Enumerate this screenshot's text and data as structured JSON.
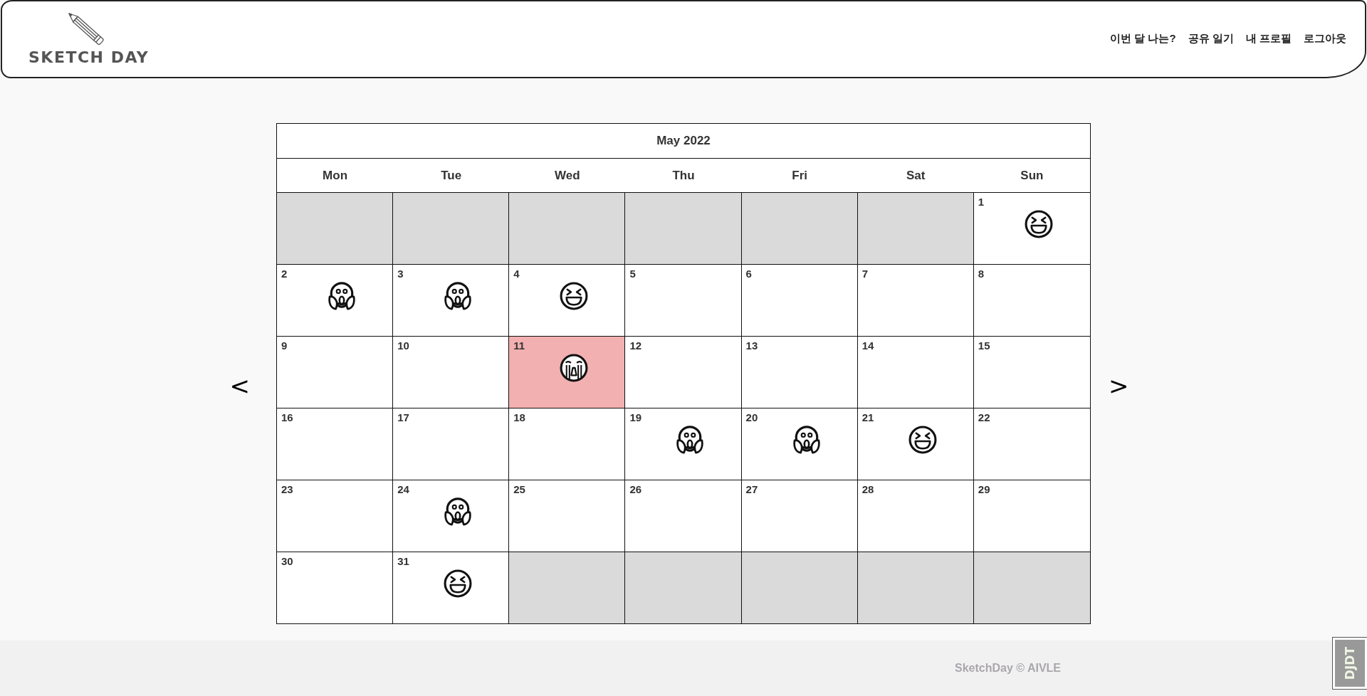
{
  "header": {
    "logo": "SKETCH DAY",
    "nav": [
      "이번 달 나는?",
      "공유 일기",
      "내 프로필",
      "로그아웃"
    ]
  },
  "calendar": {
    "prev": "<",
    "next": ">",
    "title": "May 2022",
    "weekdays": [
      "Mon",
      "Tue",
      "Wed",
      "Thu",
      "Fri",
      "Sat",
      "Sun"
    ],
    "weeks": [
      {
        "days": [
          {
            "kind": "blank"
          },
          {
            "kind": "blank"
          },
          {
            "kind": "blank"
          },
          {
            "kind": "blank"
          },
          {
            "kind": "blank"
          },
          {
            "kind": "blank"
          },
          {
            "kind": "day",
            "day": "1",
            "today": false,
            "mood": {
              "kind": "joy"
            }
          }
        ]
      },
      {
        "days": [
          {
            "kind": "day",
            "day": "2",
            "today": false,
            "mood": {
              "kind": "fear"
            }
          },
          {
            "kind": "day",
            "day": "3",
            "today": false,
            "mood": {
              "kind": "fear"
            }
          },
          {
            "kind": "day",
            "day": "4",
            "today": false,
            "mood": {
              "kind": "joy"
            }
          },
          {
            "kind": "day",
            "day": "5",
            "today": false
          },
          {
            "kind": "day",
            "day": "6",
            "today": false
          },
          {
            "kind": "day",
            "day": "7",
            "today": false
          },
          {
            "kind": "day",
            "day": "8",
            "today": false
          }
        ]
      },
      {
        "days": [
          {
            "kind": "day",
            "day": "9",
            "today": false
          },
          {
            "kind": "day",
            "day": "10",
            "today": false
          },
          {
            "kind": "day",
            "day": "11",
            "today": true,
            "mood": {
              "kind": "sadness"
            }
          },
          {
            "kind": "day",
            "day": "12",
            "today": false
          },
          {
            "kind": "day",
            "day": "13",
            "today": false
          },
          {
            "kind": "day",
            "day": "14",
            "today": false
          },
          {
            "kind": "day",
            "day": "15",
            "today": false
          }
        ]
      },
      {
        "days": [
          {
            "kind": "day",
            "day": "16",
            "today": false
          },
          {
            "kind": "day",
            "day": "17",
            "today": false
          },
          {
            "kind": "day",
            "day": "18",
            "today": false
          },
          {
            "kind": "day",
            "day": "19",
            "today": false,
            "mood": {
              "kind": "fear"
            }
          },
          {
            "kind": "day",
            "day": "20",
            "today": false,
            "mood": {
              "kind": "fear"
            }
          },
          {
            "kind": "day",
            "day": "21",
            "today": false,
            "mood": {
              "kind": "joy"
            }
          },
          {
            "kind": "day",
            "day": "22",
            "today": false
          }
        ]
      },
      {
        "days": [
          {
            "kind": "day",
            "day": "23",
            "today": false
          },
          {
            "kind": "day",
            "day": "24",
            "today": false,
            "mood": {
              "kind": "fear"
            }
          },
          {
            "kind": "day",
            "day": "25",
            "today": false
          },
          {
            "kind": "day",
            "day": "26",
            "today": false
          },
          {
            "kind": "day",
            "day": "27",
            "today": false
          },
          {
            "kind": "day",
            "day": "28",
            "today": false
          },
          {
            "kind": "day",
            "day": "29",
            "today": false
          }
        ]
      },
      {
        "days": [
          {
            "kind": "day",
            "day": "30",
            "today": false
          },
          {
            "kind": "day",
            "day": "31",
            "today": false,
            "mood": {
              "kind": "joy"
            }
          },
          {
            "kind": "blank"
          },
          {
            "kind": "blank"
          },
          {
            "kind": "blank"
          },
          {
            "kind": "blank"
          },
          {
            "kind": "blank"
          }
        ]
      }
    ]
  },
  "footer": {
    "text": "SketchDay © AIVLE"
  },
  "debug_toolbar": {
    "label": "DJDT"
  }
}
